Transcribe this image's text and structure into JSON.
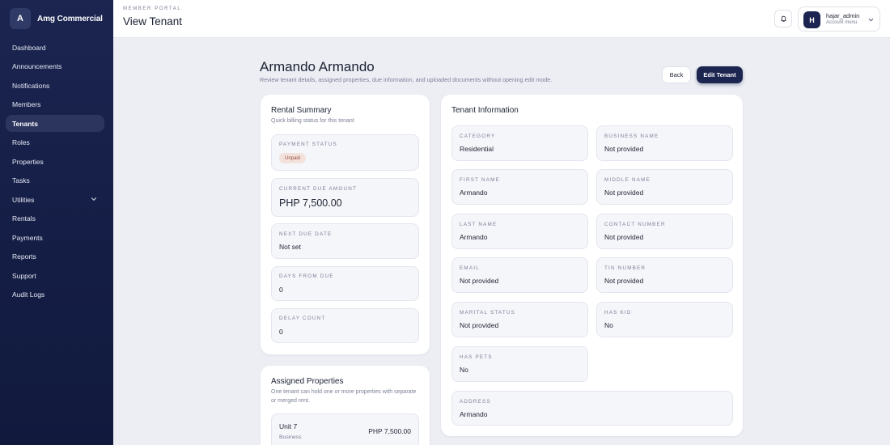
{
  "app": {
    "logo_letter": "A",
    "name": "Amg Commercial"
  },
  "sidebar": {
    "items": [
      {
        "label": "Dashboard"
      },
      {
        "label": "Announcements"
      },
      {
        "label": "Notifications"
      },
      {
        "label": "Members"
      },
      {
        "label": "Tenants",
        "active": true
      },
      {
        "label": "Roles"
      },
      {
        "label": "Properties"
      },
      {
        "label": "Tasks"
      },
      {
        "label": "Utilities",
        "has_submenu": true
      },
      {
        "label": "Rentals"
      },
      {
        "label": "Payments"
      },
      {
        "label": "Reports"
      },
      {
        "label": "Support"
      },
      {
        "label": "Audit Logs"
      }
    ]
  },
  "header": {
    "portal_label": "MEMBER PORTAL",
    "page_title": "View Tenant",
    "bell_icon": "bell-icon",
    "account": {
      "avatar_letter": "H",
      "username": "hajar_admin",
      "menu_label": "Account menu"
    }
  },
  "page": {
    "title": "Armando Armando",
    "subtitle": "Review tenant details, assigned properties, due information, and uploaded documents without opening edit mode.",
    "back_label": "Back",
    "edit_label": "Edit Tenant"
  },
  "rental_summary": {
    "title": "Rental Summary",
    "subtitle": "Quick billing status for this tenant",
    "payment_status_label": "PAYMENT STATUS",
    "payment_status_value": "Unpaid",
    "current_due_label": "CURRENT DUE AMOUNT",
    "current_due_value": "PHP 7,500.00",
    "next_due_label": "NEXT DUE DATE",
    "next_due_value": "Not set",
    "days_from_due_label": "DAYS FROM DUE",
    "days_from_due_value": "0",
    "delay_count_label": "DELAY COUNT",
    "delay_count_value": "0"
  },
  "assigned_properties": {
    "title": "Assigned Properties",
    "subtitle": "One tenant can hold one or more properties with separate or merged rent.",
    "items": [
      {
        "name": "Unit 7",
        "type": "Business",
        "amount": "PHP 7,500.00"
      }
    ]
  },
  "tenant_info": {
    "title": "Tenant Information",
    "fields": [
      {
        "label": "CATEGORY",
        "value": "Residential"
      },
      {
        "label": "BUSINESS NAME",
        "value": "Not provided"
      },
      {
        "label": "FIRST NAME",
        "value": "Armando"
      },
      {
        "label": "MIDDLE NAME",
        "value": "Not provided"
      },
      {
        "label": "LAST NAME",
        "value": "Armando"
      },
      {
        "label": "CONTACT NUMBER",
        "value": "Not provided"
      },
      {
        "label": "EMAIL",
        "value": "Not provided"
      },
      {
        "label": "TIN NUMBER",
        "value": "Not provided"
      },
      {
        "label": "MARITAL STATUS",
        "value": "Not provided"
      },
      {
        "label": "HAS KID",
        "value": "No"
      },
      {
        "label": "HAS PETS",
        "value": "No"
      },
      {
        "label": "ADDRESS",
        "value": "Armando"
      }
    ]
  },
  "colors": {
    "sidebar_bg": "#141d44",
    "accent": "#1b2550",
    "page_bg": "#eceef4",
    "badge_bg": "#f3e2dc",
    "badge_text": "#9a4a3a"
  }
}
